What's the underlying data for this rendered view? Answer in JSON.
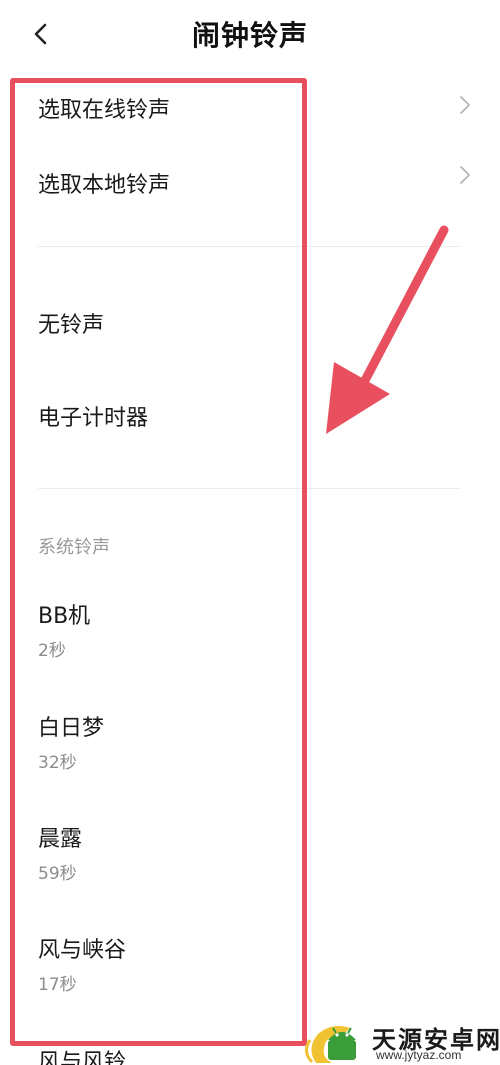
{
  "header": {
    "title": "闹钟铃声"
  },
  "options": {
    "online": "选取在线铃声",
    "local": "选取本地铃声"
  },
  "quick": {
    "none": "无铃声",
    "timer": "电子计时器"
  },
  "system": {
    "section_label": "系统铃声",
    "items": [
      {
        "name": "BB机",
        "duration": "2秒"
      },
      {
        "name": "白日梦",
        "duration": "32秒"
      },
      {
        "name": "晨露",
        "duration": "59秒"
      },
      {
        "name": "风与峡谷",
        "duration": "17秒"
      },
      {
        "name": "风与风铃"
      }
    ]
  },
  "watermark": {
    "title": "天源安卓网",
    "url": "www.jytyaz.com"
  },
  "colors": {
    "highlight": "#e8505f",
    "logo_green": "#3a9d3a",
    "secondary_text": "#8c8c8c"
  },
  "icons": {
    "back": "chevron-left-icon",
    "row_arrow": "chevron-right-icon"
  }
}
